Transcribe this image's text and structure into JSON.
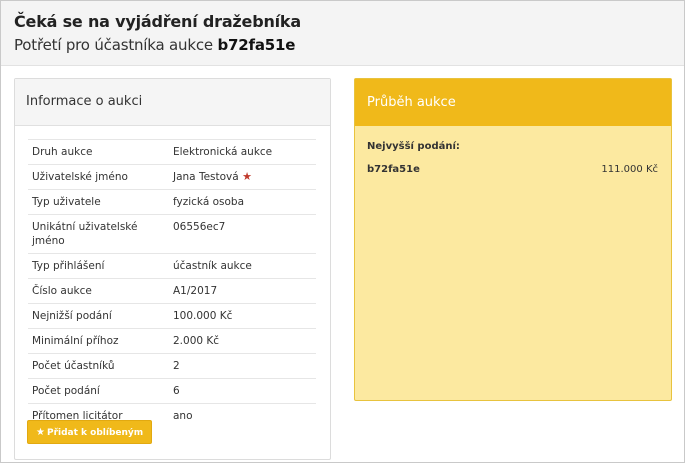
{
  "header": {
    "title": "Čeká se na vyjádření dražebníka",
    "subtitle_prefix": "Potřetí pro účastníka aukce",
    "subtitle_id": "b72fa51e"
  },
  "info_panel": {
    "heading": "Informace o aukci",
    "rows": [
      {
        "label": "Druh aukce",
        "value": "Elektronická aukce"
      },
      {
        "label": "Uživatelské jméno",
        "value": "Jana Testová"
      },
      {
        "label": "Typ uživatele",
        "value": "fyzická osoba"
      },
      {
        "label": "Unikátní uživatelské jméno",
        "value": "06556ec7"
      },
      {
        "label": "Typ přihlášení",
        "value": "účastník aukce"
      },
      {
        "label": "Číslo aukce",
        "value": "A1/2017"
      },
      {
        "label": "Nejnižší podání",
        "value": "100.000 Kč"
      },
      {
        "label": "Minimální příhoz",
        "value": "2.000 Kč"
      },
      {
        "label": "Počet účastníků",
        "value": "2"
      },
      {
        "label": "Počet podání",
        "value": "6"
      },
      {
        "label": "Přítomen licitátor",
        "value": "ano"
      }
    ],
    "favorite_button": "Přidat k oblíbeným"
  },
  "progress_panel": {
    "heading": "Průběh aukce",
    "highest_bid_label": "Nejvyšší podání:",
    "bidder": "b72fa51e",
    "amount": "111.000 Kč"
  },
  "colors": {
    "accent": "#f0b91a",
    "panel_yellow": "#fce9a0",
    "star_red": "#c0392b"
  },
  "icons": [
    "star-icon"
  ]
}
